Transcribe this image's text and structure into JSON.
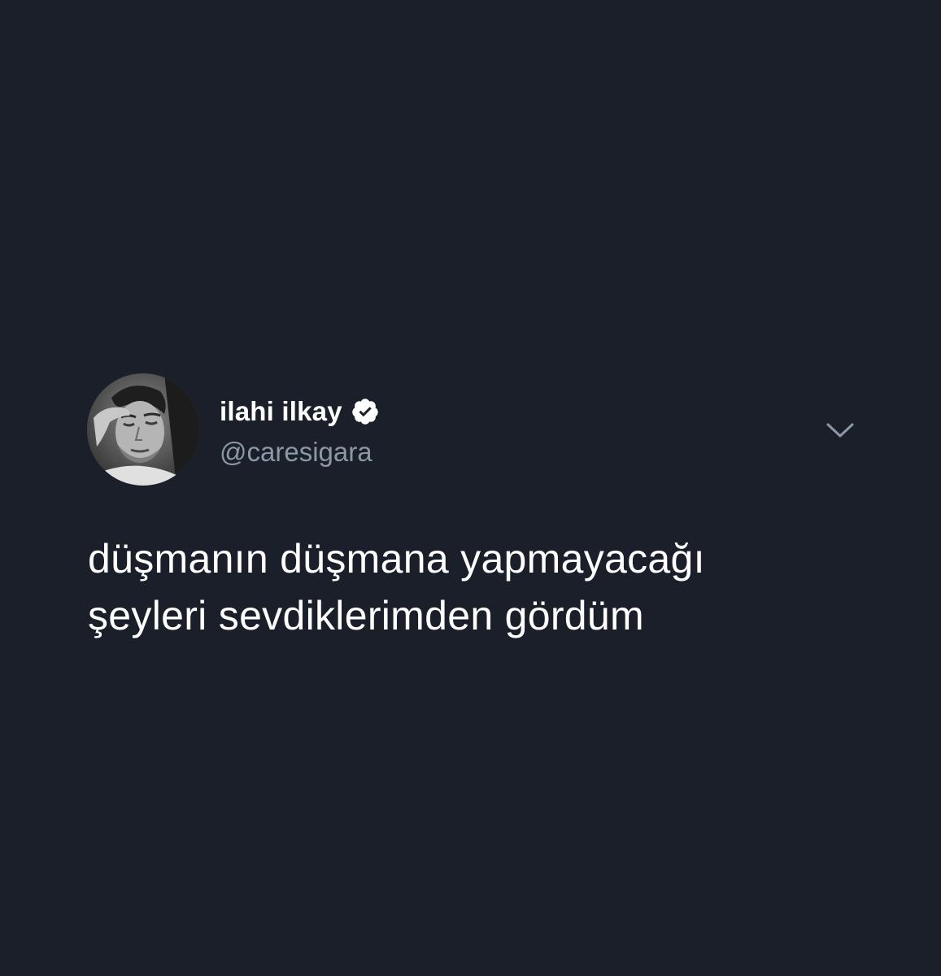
{
  "colors": {
    "background": "#1a1f29",
    "name": "#ffffff",
    "handle": "#8b98a5",
    "text": "#ffffff",
    "verified_badge": "#ffffff",
    "chevron": "#8b98a5"
  },
  "tweet": {
    "author": {
      "display_name": "ilahi ilkay",
      "handle": "@caresigara",
      "verified": true,
      "avatar_icon": "avatar-photo"
    },
    "menu_icon": "chevron-down-icon",
    "text_lines": [
      "düşmanın düşmana yapmayacağı",
      "şeyleri sevdiklerimden gördüm"
    ]
  }
}
